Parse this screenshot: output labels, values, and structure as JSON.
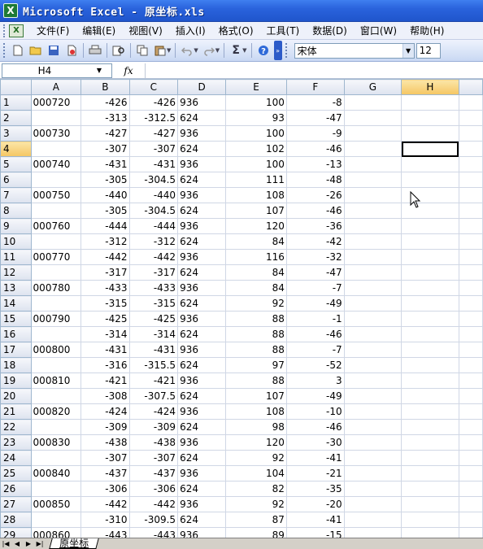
{
  "window": {
    "title": "Microsoft Excel - 原坐标.xls"
  },
  "menu": [
    "文件(F)",
    "编辑(E)",
    "视图(V)",
    "插入(I)",
    "格式(O)",
    "工具(T)",
    "数据(D)",
    "窗口(W)",
    "帮助(H)"
  ],
  "toolbar": {
    "font_name": "宋体",
    "font_size": "12",
    "autosum": "Σ"
  },
  "formula_bar": {
    "name_box": "H4",
    "fx_label": "fx",
    "value": ""
  },
  "columns": [
    "A",
    "B",
    "C",
    "D",
    "E",
    "F",
    "G",
    "H"
  ],
  "rows": [
    {
      "n": "1",
      "a": "000720",
      "b": "-426",
      "c": "-426",
      "d": "936",
      "e": "100",
      "f": "-8"
    },
    {
      "n": "2",
      "a": "",
      "b": "-313",
      "c": "-312.5",
      "d": "624",
      "e": "93",
      "f": "-47"
    },
    {
      "n": "3",
      "a": "000730",
      "b": "-427",
      "c": "-427",
      "d": "936",
      "e": "100",
      "f": "-9"
    },
    {
      "n": "4",
      "a": "",
      "b": "-307",
      "c": "-307",
      "d": "624",
      "e": "102",
      "f": "-46"
    },
    {
      "n": "5",
      "a": "000740",
      "b": "-431",
      "c": "-431",
      "d": "936",
      "e": "100",
      "f": "-13"
    },
    {
      "n": "6",
      "a": "",
      "b": "-305",
      "c": "-304.5",
      "d": "624",
      "e": "111",
      "f": "-48"
    },
    {
      "n": "7",
      "a": "000750",
      "b": "-440",
      "c": "-440",
      "d": "936",
      "e": "108",
      "f": "-26"
    },
    {
      "n": "8",
      "a": "",
      "b": "-305",
      "c": "-304.5",
      "d": "624",
      "e": "107",
      "f": "-46"
    },
    {
      "n": "9",
      "a": "000760",
      "b": "-444",
      "c": "-444",
      "d": "936",
      "e": "120",
      "f": "-36"
    },
    {
      "n": "10",
      "a": "",
      "b": "-312",
      "c": "-312",
      "d": "624",
      "e": "84",
      "f": "-42"
    },
    {
      "n": "11",
      "a": "000770",
      "b": "-442",
      "c": "-442",
      "d": "936",
      "e": "116",
      "f": "-32"
    },
    {
      "n": "12",
      "a": "",
      "b": "-317",
      "c": "-317",
      "d": "624",
      "e": "84",
      "f": "-47"
    },
    {
      "n": "13",
      "a": "000780",
      "b": "-433",
      "c": "-433",
      "d": "936",
      "e": "84",
      "f": "-7"
    },
    {
      "n": "14",
      "a": "",
      "b": "-315",
      "c": "-315",
      "d": "624",
      "e": "92",
      "f": "-49"
    },
    {
      "n": "15",
      "a": "000790",
      "b": "-425",
      "c": "-425",
      "d": "936",
      "e": "88",
      "f": "-1"
    },
    {
      "n": "16",
      "a": "",
      "b": "-314",
      "c": "-314",
      "d": "624",
      "e": "88",
      "f": "-46"
    },
    {
      "n": "17",
      "a": "000800",
      "b": "-431",
      "c": "-431",
      "d": "936",
      "e": "88",
      "f": "-7"
    },
    {
      "n": "18",
      "a": "",
      "b": "-316",
      "c": "-315.5",
      "d": "624",
      "e": "97",
      "f": "-52"
    },
    {
      "n": "19",
      "a": "000810",
      "b": "-421",
      "c": "-421",
      "d": "936",
      "e": "88",
      "f": "3"
    },
    {
      "n": "20",
      "a": "",
      "b": "-308",
      "c": "-307.5",
      "d": "624",
      "e": "107",
      "f": "-49"
    },
    {
      "n": "21",
      "a": "000820",
      "b": "-424",
      "c": "-424",
      "d": "936",
      "e": "108",
      "f": "-10"
    },
    {
      "n": "22",
      "a": "",
      "b": "-309",
      "c": "-309",
      "d": "624",
      "e": "98",
      "f": "-46"
    },
    {
      "n": "23",
      "a": "000830",
      "b": "-438",
      "c": "-438",
      "d": "936",
      "e": "120",
      "f": "-30"
    },
    {
      "n": "24",
      "a": "",
      "b": "-307",
      "c": "-307",
      "d": "624",
      "e": "92",
      "f": "-41"
    },
    {
      "n": "25",
      "a": "000840",
      "b": "-437",
      "c": "-437",
      "d": "936",
      "e": "104",
      "f": "-21"
    },
    {
      "n": "26",
      "a": "",
      "b": "-306",
      "c": "-306",
      "d": "624",
      "e": "82",
      "f": "-35"
    },
    {
      "n": "27",
      "a": "000850",
      "b": "-442",
      "c": "-442",
      "d": "936",
      "e": "92",
      "f": "-20"
    },
    {
      "n": "28",
      "a": "",
      "b": "-310",
      "c": "-309.5",
      "d": "624",
      "e": "87",
      "f": "-41"
    },
    {
      "n": "29",
      "a": "000860",
      "b": "-443",
      "c": "-443",
      "d": "936",
      "e": "89",
      "f": "-15"
    }
  ],
  "selected_cell": {
    "row": "4",
    "col": "H"
  },
  "sheet_tabs": [
    "原坐标"
  ],
  "colors": {
    "title_bar": "#2a63dc",
    "grid_line": "#d0d7e5",
    "header_selected": "#f5c663"
  }
}
